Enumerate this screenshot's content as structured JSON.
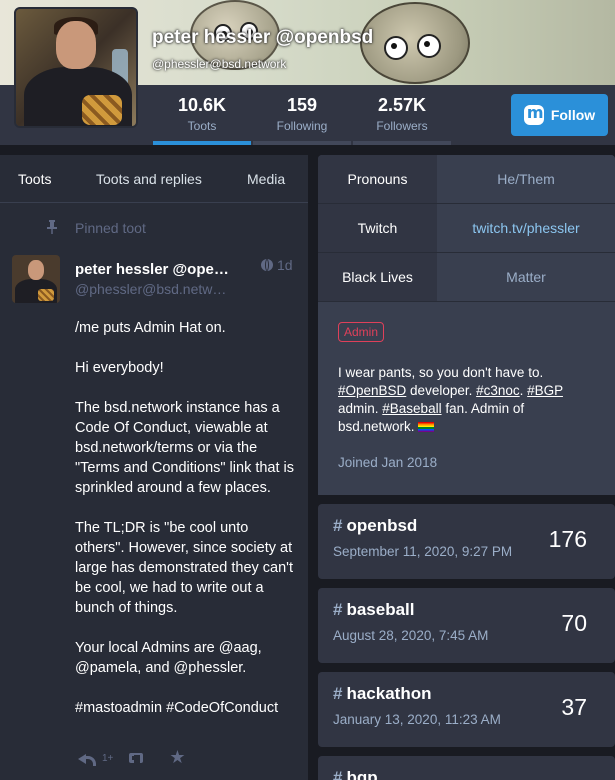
{
  "profile": {
    "display_name": "peter hessler @openbsd",
    "acct": "@phessler@bsd.network",
    "follow_label": "Follow",
    "counters": [
      {
        "value": "10.6K",
        "label": "Toots",
        "active": true
      },
      {
        "value": "159",
        "label": "Following",
        "active": false
      },
      {
        "value": "2.57K",
        "label": "Followers",
        "active": false
      }
    ]
  },
  "tabs": [
    {
      "label": "Toots",
      "active": true
    },
    {
      "label": "Toots and replies",
      "active": false
    },
    {
      "label": "Media",
      "active": false
    }
  ],
  "pinned": {
    "label": "Pinned toot",
    "author_name": "peter hessler @openbsd",
    "author_acct": "@phessler@bsd.network",
    "time": "1d",
    "paragraphs": [
      "/me puts Admin Hat on.",
      "Hi everybody!",
      "The bsd.network instance has a Code Of Conduct, viewable at bsd.network/terms or via the \"Terms and Conditions\" link that is sprinkled around a few places.",
      "The TL;DR is \"be cool unto others\".  However, since society at large has demonstrated they can't be cool, we had to write out a bunch of things.",
      "Your local Admins are @aag, @pamela, and @phessler.",
      "#mastoadmin #CodeOfConduct"
    ],
    "reply_count": "1+"
  },
  "fields": [
    {
      "name": "Pronouns",
      "value": "He/Them",
      "link": false
    },
    {
      "name": "Twitch",
      "value": "twitch.tv/phessler",
      "link": true
    },
    {
      "name": "Black Lives",
      "value": "Matter",
      "link": false
    }
  ],
  "bio": {
    "badge": "Admin",
    "line1": "I wear pants, so you don't have to.",
    "tag_openbsd": "#OpenBSD",
    "text_developer": " developer. ",
    "tag_c3noc": "#c3noc",
    "text_dot": ". ",
    "tag_bgp": "#BGP",
    "text_admin": " admin. ",
    "tag_baseball": "#Baseball",
    "text_fan": " fan. Admin of bsd.network.",
    "joined": "Joined Jan 2018"
  },
  "hashtags": [
    {
      "name": "openbsd",
      "date": "September 11, 2020, 9:27 PM",
      "count": "176"
    },
    {
      "name": "baseball",
      "date": "August 28, 2020, 7:45 AM",
      "count": "70"
    },
    {
      "name": "hackathon",
      "date": "January 13, 2020, 11:23 AM",
      "count": "37"
    },
    {
      "name": "bgp",
      "date": "",
      "count": ""
    }
  ]
}
